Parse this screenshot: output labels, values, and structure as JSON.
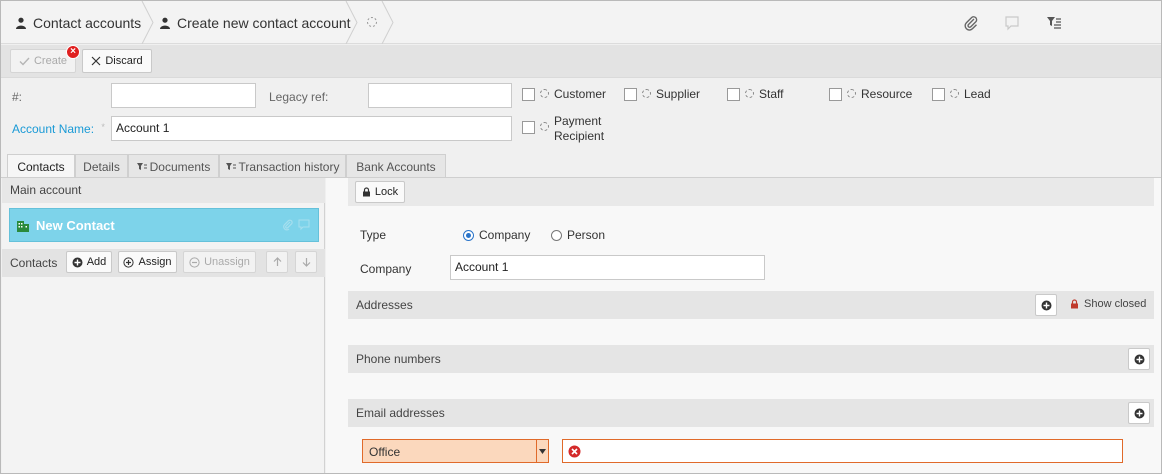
{
  "breadcrumb": {
    "items": [
      {
        "label": "Contact accounts"
      },
      {
        "label": "Create new contact account"
      }
    ]
  },
  "toolbar": {
    "create_label": "Create",
    "discard_label": "Discard"
  },
  "form": {
    "number_label": "#:",
    "number_value": "",
    "legacy_label": "Legacy ref:",
    "legacy_value": "",
    "account_name_label": "Account Name:",
    "required_mark": "*",
    "account_name_value": "Account 1",
    "roles": [
      {
        "label": "Customer"
      },
      {
        "label": "Supplier"
      },
      {
        "label": "Staff"
      },
      {
        "label": "Resource"
      },
      {
        "label": "Lead"
      },
      {
        "label": "Payment Recipient"
      }
    ]
  },
  "tabs": [
    {
      "label": "Contacts",
      "active": true
    },
    {
      "label": "Details"
    },
    {
      "label": "Documents"
    },
    {
      "label": "Transaction history"
    },
    {
      "label": "Bank Accounts"
    }
  ],
  "left": {
    "main_account_label": "Main account",
    "contact_card_label": "New Contact",
    "contacts_label": "Contacts",
    "add_label": "Add",
    "assign_label": "Assign",
    "unassign_label": "Unassign"
  },
  "right": {
    "lock_label": "Lock",
    "type_label": "Type",
    "type_company": "Company",
    "type_person": "Person",
    "company_label": "Company",
    "company_value": "Account 1",
    "addresses_label": "Addresses",
    "show_closed_label": "Show closed",
    "phones_label": "Phone numbers",
    "emails_label": "Email addresses",
    "email_type_value": "Office",
    "email_value": ""
  },
  "colors": {
    "accent": "#1a9ad6",
    "contact_card": "#7dd3ea",
    "error": "#e02020",
    "email_type_bg": "#fbd8bd"
  }
}
